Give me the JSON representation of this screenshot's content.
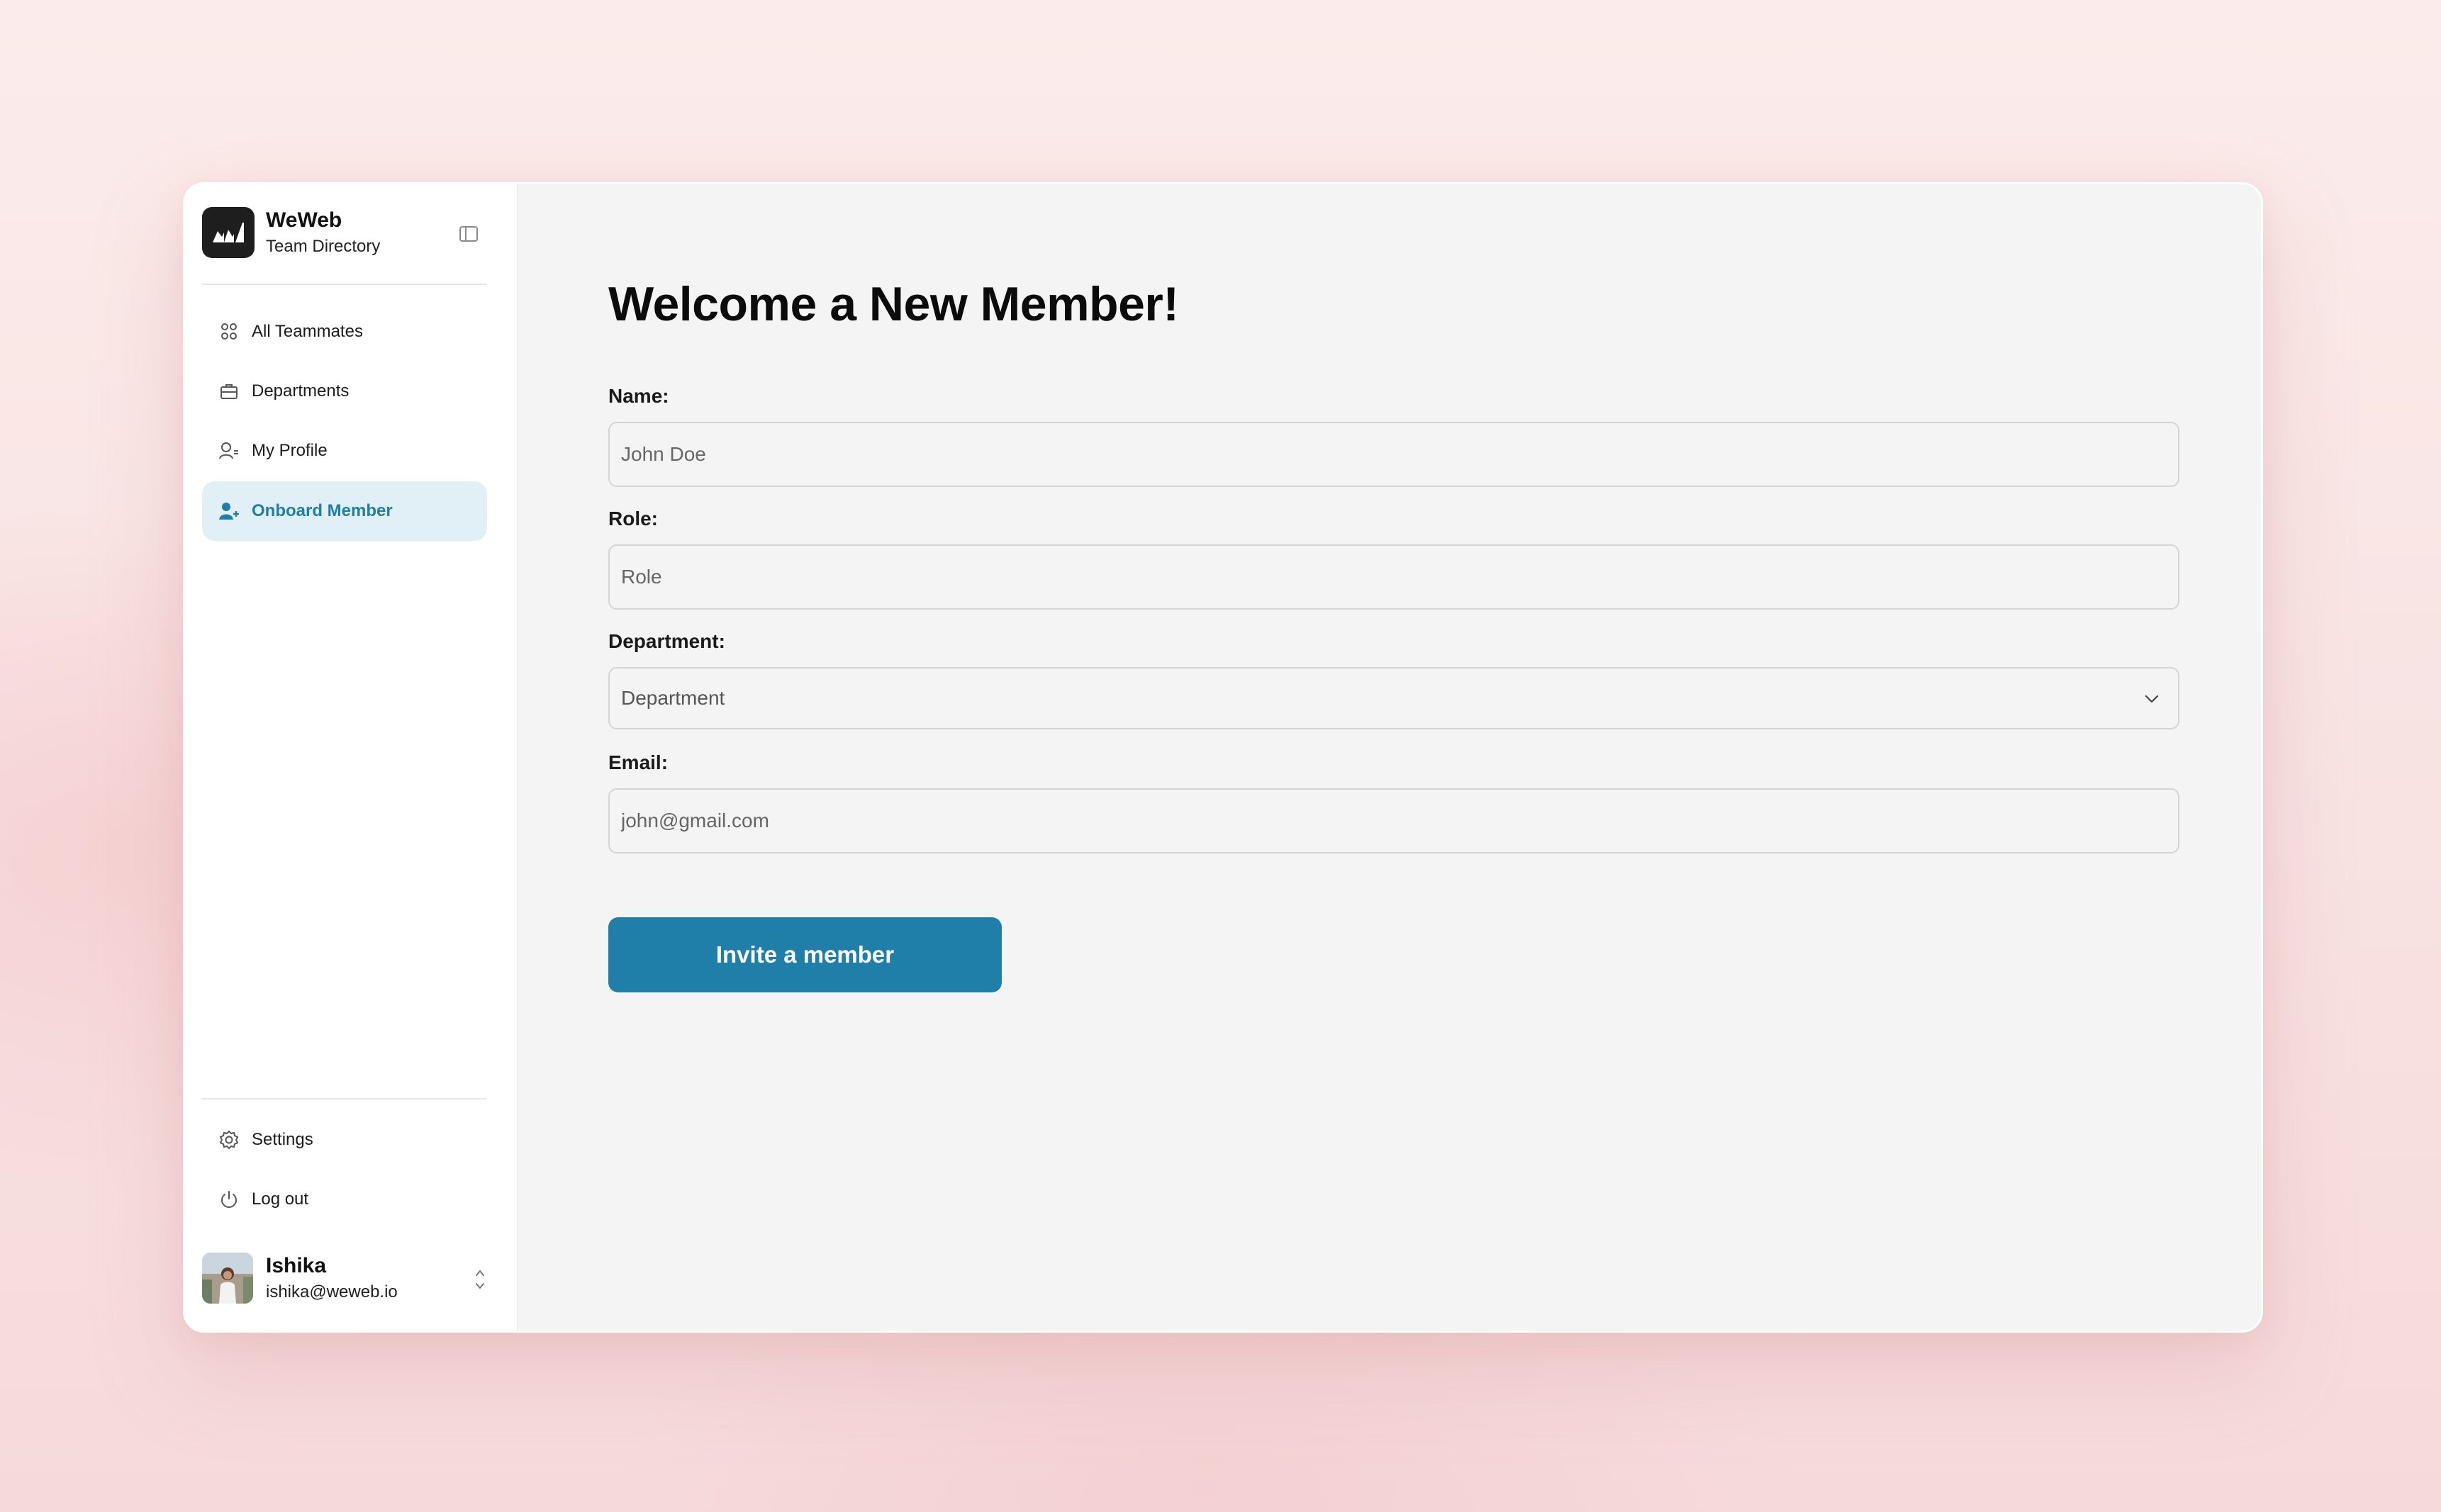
{
  "brand": {
    "name": "WeWeb",
    "subtitle": "Team Directory"
  },
  "nav": {
    "items": [
      {
        "label": "All Teammates",
        "icon": "users-grid-icon"
      },
      {
        "label": "Departments",
        "icon": "briefcase-icon"
      },
      {
        "label": "My Profile",
        "icon": "user-profile-icon"
      },
      {
        "label": "Onboard Member",
        "icon": "user-add-icon",
        "active": true
      }
    ],
    "footer": [
      {
        "label": "Settings",
        "icon": "gear-icon"
      },
      {
        "label": "Log out",
        "icon": "power-icon"
      }
    ]
  },
  "user": {
    "name": "Ishika",
    "email": "ishika@weweb.io"
  },
  "main": {
    "title": "Welcome a New Member!",
    "form": {
      "name_label": "Name:",
      "name_placeholder": "John Doe",
      "role_label": "Role:",
      "role_placeholder": "Role",
      "department_label": "Department:",
      "department_value": "Department",
      "email_label": "Email:",
      "email_placeholder": "john@gmail.com",
      "submit_label": "Invite a member"
    }
  },
  "colors": {
    "accent": "#1f7fa8",
    "active_nav_bg": "#e1f0f7",
    "page_bg": "#f9e6e6",
    "panel_bg": "#f4f4f4"
  }
}
